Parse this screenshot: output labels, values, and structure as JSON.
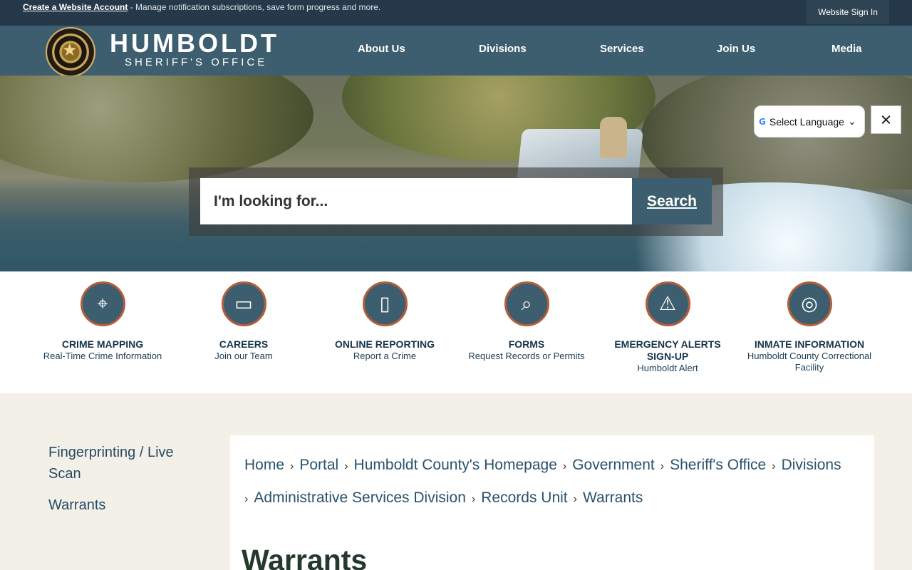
{
  "topbar": {
    "create_link": "Create a Website Account",
    "note": " - Manage notification subscriptions, save form progress and more.",
    "signin": "Website Sign In"
  },
  "brand": {
    "name": "HUMBOLDT",
    "subtitle": "SHERIFF'S OFFICE"
  },
  "nav": [
    "About Us",
    "Divisions",
    "Services",
    "Join Us",
    "Media"
  ],
  "search": {
    "placeholder": "I'm looking for...",
    "button": "Search"
  },
  "language": {
    "selected": "Select Language",
    "close": "×",
    "google": "G"
  },
  "quick_links": [
    {
      "title": "CRIME MAPPING",
      "sub": "Real-Time Crime Information",
      "icon": "map-pin-icon"
    },
    {
      "title": "CAREERS",
      "sub": "Join our Team",
      "icon": "briefcase-icon"
    },
    {
      "title": "ONLINE REPORTING",
      "sub": "Report a Crime",
      "icon": "phone-icon"
    },
    {
      "title": "FORMS",
      "sub": "Request Records or Permits",
      "icon": "folder-search-icon"
    },
    {
      "title": "EMERGENCY ALERTS SIGN-UP",
      "sub": "Humboldt Alert",
      "icon": "alert-icon"
    },
    {
      "title": "INMATE INFORMATION",
      "sub": "Humboldt County Correctional Facility",
      "icon": "fingerprint-icon"
    }
  ],
  "sidebar": {
    "items": [
      "Fingerprinting / Live Scan",
      "Warrants"
    ]
  },
  "breadcrumbs": [
    "Home",
    "Portal",
    "Humboldt County's Homepage",
    "Government",
    "Sheriff's Office",
    "Divisions",
    "Administrative Services Division",
    "Records Unit",
    "Warrants"
  ],
  "page_title": "Warrants",
  "colors": {
    "topbar": "#25394a",
    "header": "#3c5e6e",
    "accent": "#b45e3a",
    "page_bg": "#f3f0e8"
  }
}
